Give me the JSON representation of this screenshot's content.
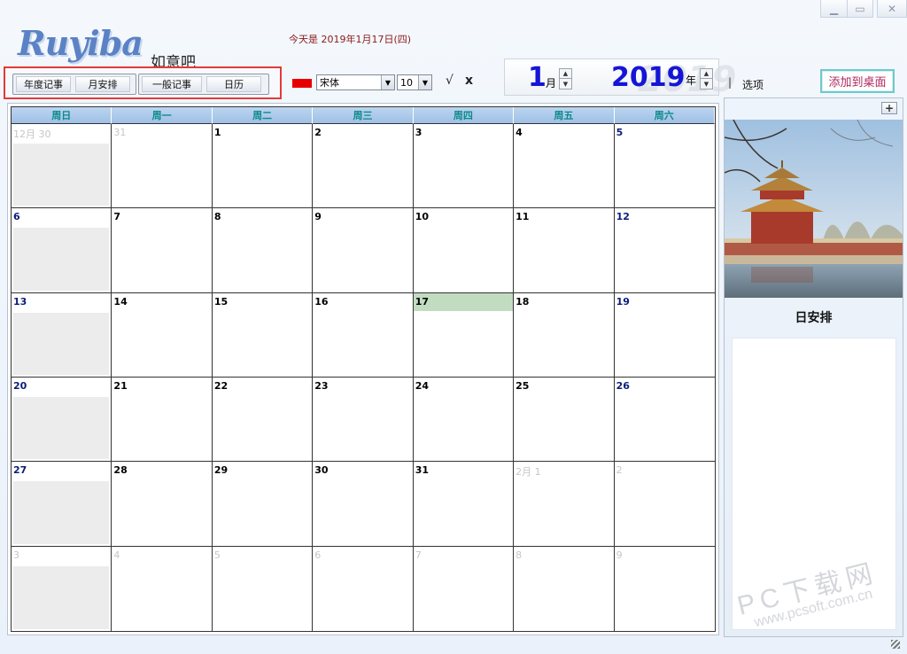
{
  "window": {
    "min_icon": "minimize-icon",
    "max_icon": "maximize-icon",
    "close_icon": "close-icon"
  },
  "logo": {
    "text": "Ruyiba",
    "subtitle": "如意吧"
  },
  "today_label": "今天是 2019年1月17日(四)",
  "toolbar": {
    "group1": [
      "年度记事",
      "月安排"
    ],
    "group2": [
      "一般记事",
      "日历"
    ],
    "color": "#e60000",
    "font_value": "宋体",
    "size_value": "10",
    "check": "√",
    "cross": "x"
  },
  "date": {
    "month": "1",
    "month_unit": "月",
    "year": "2019",
    "year_unit": "年"
  },
  "separator": "|",
  "options_label": "选项",
  "add_desktop_label": "添加到桌面",
  "calendar": {
    "weekdays": [
      "周日",
      "周一",
      "周二",
      "周三",
      "周四",
      "周五",
      "周六"
    ],
    "days": [
      {
        "label": "12月 30",
        "other": true
      },
      {
        "label": "31",
        "other": true
      },
      {
        "label": "1"
      },
      {
        "label": "2"
      },
      {
        "label": "3"
      },
      {
        "label": "4"
      },
      {
        "label": "5"
      },
      {
        "label": "6"
      },
      {
        "label": "7"
      },
      {
        "label": "8"
      },
      {
        "label": "9"
      },
      {
        "label": "10"
      },
      {
        "label": "11"
      },
      {
        "label": "12"
      },
      {
        "label": "13"
      },
      {
        "label": "14"
      },
      {
        "label": "15"
      },
      {
        "label": "16"
      },
      {
        "label": "17",
        "today": true
      },
      {
        "label": "18"
      },
      {
        "label": "19"
      },
      {
        "label": "20"
      },
      {
        "label": "21"
      },
      {
        "label": "22"
      },
      {
        "label": "23"
      },
      {
        "label": "24"
      },
      {
        "label": "25"
      },
      {
        "label": "26"
      },
      {
        "label": "27"
      },
      {
        "label": "28"
      },
      {
        "label": "29"
      },
      {
        "label": "30"
      },
      {
        "label": "31"
      },
      {
        "label": "2月 1",
        "other": true
      },
      {
        "label": "2",
        "other": true
      },
      {
        "label": "3",
        "other": true
      },
      {
        "label": "4",
        "other": true
      },
      {
        "label": "5",
        "other": true
      },
      {
        "label": "6",
        "other": true
      },
      {
        "label": "7",
        "other": true
      },
      {
        "label": "8",
        "other": true
      },
      {
        "label": "9",
        "other": true
      }
    ]
  },
  "side": {
    "plus": "+",
    "day_schedule_title": "日安排"
  },
  "watermark": {
    "line1": "PC下载网",
    "line2": "www.pcsoft.com.cn"
  }
}
